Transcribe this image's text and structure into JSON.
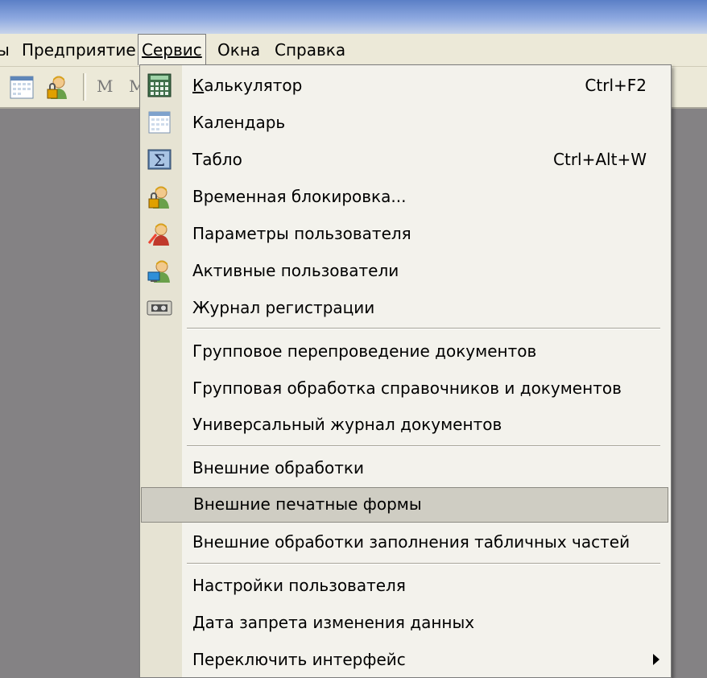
{
  "menubar": {
    "items": [
      {
        "label": "ы"
      },
      {
        "label": "Предприятие"
      },
      {
        "label": "Сервис"
      },
      {
        "label": "Окна"
      },
      {
        "label": "Справка"
      }
    ]
  },
  "toolbar": {
    "text_m1": "М",
    "text_m2": "М"
  },
  "menu": {
    "items": [
      {
        "label": "Калькулятор",
        "shortcut": "Ctrl+F2",
        "icon": "calculator-icon"
      },
      {
        "label": "Календарь",
        "shortcut": "",
        "icon": "calendar-icon"
      },
      {
        "label": "Табло",
        "shortcut": "Ctrl+Alt+W",
        "icon": "sum-board-icon"
      },
      {
        "label": "Временная блокировка...",
        "shortcut": "",
        "icon": "user-lock-icon"
      },
      {
        "label": "Параметры пользователя",
        "shortcut": "",
        "icon": "user-settings-icon"
      },
      {
        "label": "Активные пользователи",
        "shortcut": "",
        "icon": "active-users-icon"
      },
      {
        "label": "Журнал регистрации",
        "shortcut": "",
        "icon": "journal-tape-icon"
      },
      {
        "label": "Групповое перепроведение документов",
        "shortcut": ""
      },
      {
        "label": "Групповая обработка справочников и документов",
        "shortcut": ""
      },
      {
        "label": "Универсальный журнал документов",
        "shortcut": ""
      },
      {
        "label": "Внешние обработки",
        "shortcut": ""
      },
      {
        "label": "Внешние печатные формы",
        "shortcut": "",
        "highlighted": true
      },
      {
        "label": "Внешние обработки заполнения табличных частей",
        "shortcut": ""
      },
      {
        "label": "Настройки пользователя",
        "shortcut": ""
      },
      {
        "label": "Дата запрета изменения данных",
        "shortcut": ""
      },
      {
        "label": "Переключить интерфейс",
        "shortcut": "",
        "submenu": true
      }
    ]
  }
}
